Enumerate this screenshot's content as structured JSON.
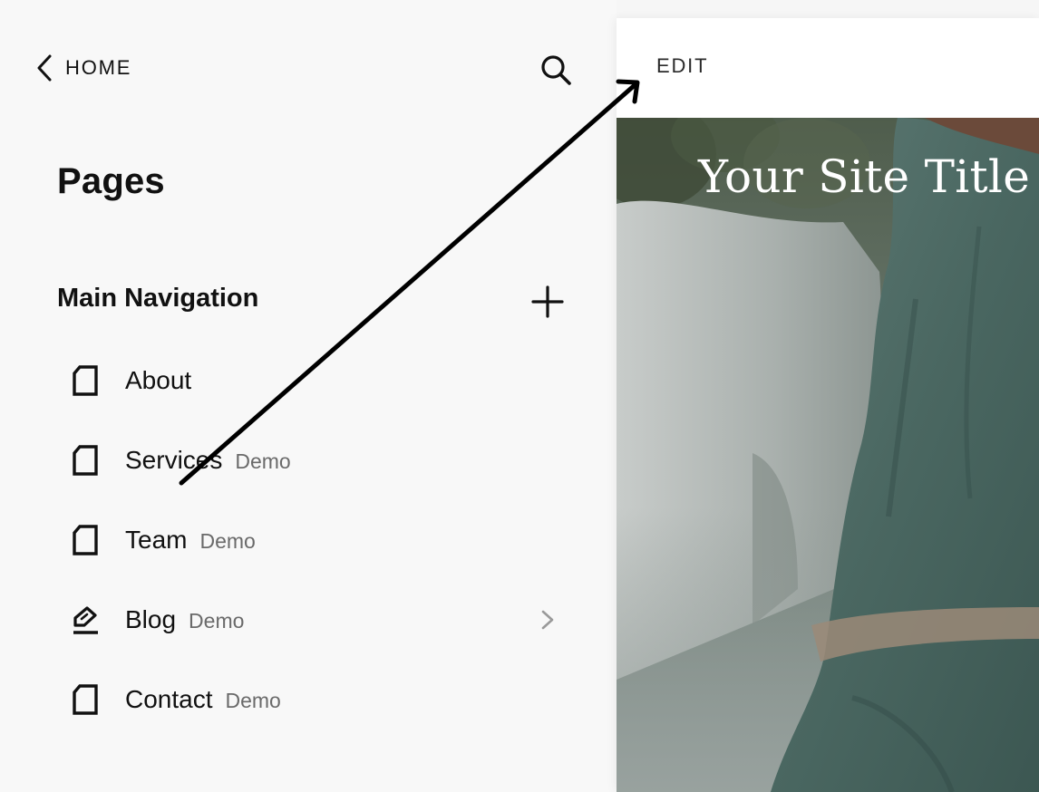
{
  "sidebar": {
    "back_label": "HOME",
    "title": "Pages",
    "section_title": "Main Navigation",
    "items": [
      {
        "label": "About",
        "badge": "",
        "icon": "page-icon"
      },
      {
        "label": "Services",
        "badge": "Demo",
        "icon": "page-icon"
      },
      {
        "label": "Team",
        "badge": "Demo",
        "icon": "page-icon"
      },
      {
        "label": "Blog",
        "badge": "Demo",
        "icon": "blog-pen-icon",
        "has_children": true
      },
      {
        "label": "Contact",
        "badge": "Demo",
        "icon": "page-icon"
      }
    ],
    "icons": {
      "back": "chevron-left-icon",
      "search": "search-icon",
      "add": "plus-icon",
      "expand": "chevron-right-icon"
    }
  },
  "preview": {
    "edit_label": "EDIT",
    "site_title": "Your Site Title"
  },
  "colors": {
    "sidebar_bg": "#f8f8f8",
    "text": "#111111",
    "badge_text": "#6a6a6a",
    "hero_tone": "#5f6e63"
  }
}
